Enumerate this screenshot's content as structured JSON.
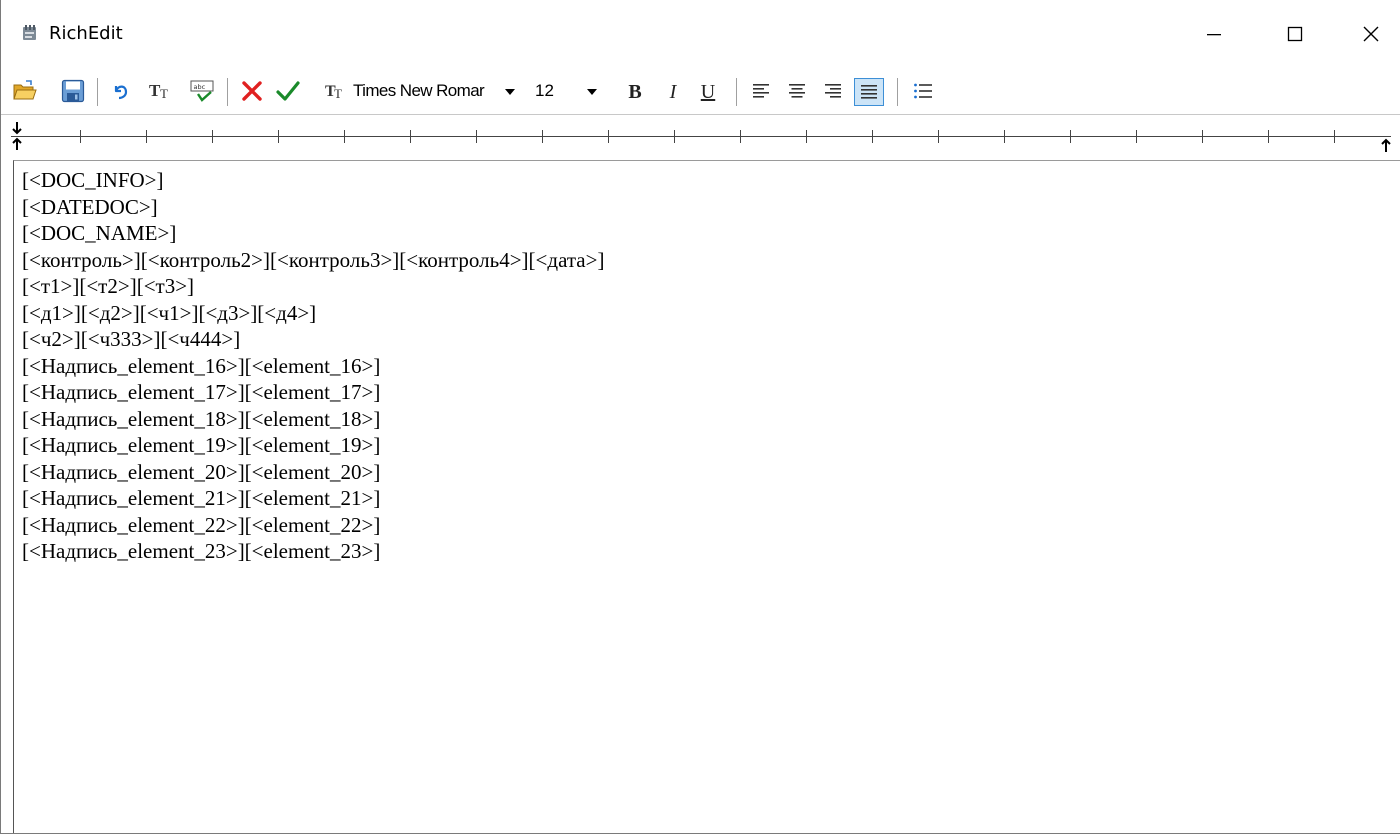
{
  "window": {
    "title": "RichEdit"
  },
  "toolbar": {
    "font_name": "Times New Romar",
    "font_size": "12",
    "bold_label": "B",
    "italic_label": "I",
    "underline_label": "U",
    "icons": [
      "open-icon",
      "save-icon",
      "undo-icon",
      "font-icon",
      "spellcheck-icon",
      "cancel-icon",
      "accept-icon",
      "bold-icon",
      "italic-icon",
      "underline-icon",
      "align-left-icon",
      "align-center-icon",
      "align-right-icon",
      "justify-icon",
      "bullet-list-icon"
    ],
    "colors": {
      "cancel": "#e02020",
      "accept": "#1a8a2a",
      "active_button": "#cce4f7"
    }
  },
  "document": {
    "lines": [
      "[<DOC_INFO>]",
      "[<DATEDOC>]",
      "[<DOC_NAME>]",
      "[<контроль>][<контроль2>][<контроль3>][<контроль4>][<дата>]",
      "[<т1>][<т2>][<т3>]",
      "[<д1>][<д2>][<ч1>][<д3>][<д4>]",
      "[<ч2>][<ч333>][<ч444>]",
      "[<Надпись_element_16>][<element_16>]",
      "[<Надпись_element_17>][<element_17>]",
      "[<Надпись_element_18>][<element_18>]",
      "[<Надпись_element_19>][<element_19>]",
      "[<Надпись_element_20>][<element_20>]",
      "[<Надпись_element_21>][<element_21>]",
      "[<Надпись_element_22>][<element_22>]",
      "[<Надпись_element_23>][<element_23>]"
    ]
  }
}
